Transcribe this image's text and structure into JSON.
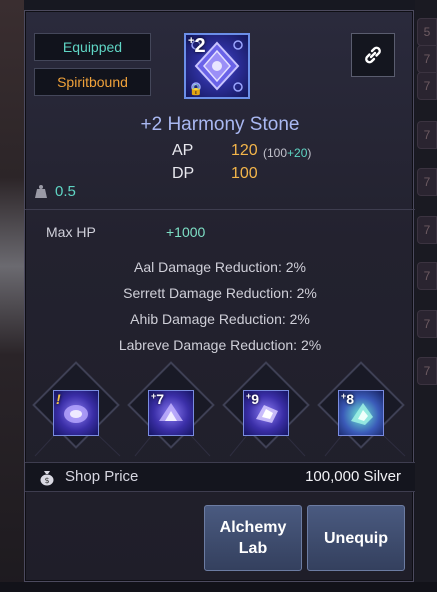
{
  "background": {
    "right_slot_numbers": [
      "5",
      "7",
      "7",
      "7",
      "7",
      "7",
      "7",
      "7",
      "7"
    ]
  },
  "tooltip": {
    "equipped_label": "Equipped",
    "spiritbound_label": "Spiritbound",
    "item_icon": {
      "enhance_level": "2",
      "lock_icon": "lock-icon"
    },
    "link_icon": "link-icon",
    "item_name": "+2 Harmony Stone",
    "stats": {
      "ap_label": "AP",
      "ap_value": "120",
      "ap_breakdown_base": "(100",
      "ap_breakdown_plus": "+20",
      "ap_breakdown_close": ")",
      "dp_label": "DP",
      "dp_value": "100"
    },
    "weight": "0.5",
    "max_hp_label": "Max HP",
    "max_hp_value": "+1000",
    "reductions": [
      "Aal Damage Reduction: 2%",
      "Serrett Damage Reduction: 2%",
      "Ahib Damage Reduction: 2%",
      "Labreve Damage Reduction: 2%"
    ],
    "sockets": [
      {
        "label": "!"
      },
      {
        "label": "7"
      },
      {
        "label": "9"
      },
      {
        "label": "8"
      }
    ],
    "shop_price_label": "Shop Price",
    "shop_price_value": "100,000 Silver",
    "buttons": {
      "alchemy_lab_line1": "Alchemy",
      "alchemy_lab_line2": "Lab",
      "unequip": "Unequip"
    },
    "colors": {
      "teal": "#5fd5c4",
      "orange": "#f0a23a",
      "gold": "#f3b54a",
      "name_blue": "#a9b8f2"
    }
  }
}
